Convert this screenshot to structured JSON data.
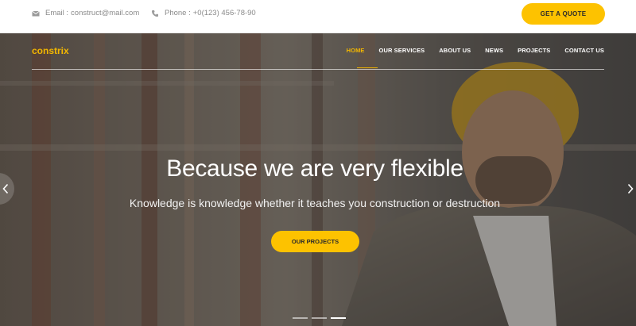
{
  "topbar": {
    "email_label": "Email :",
    "email_value": "construct@mail.com",
    "phone_label": "Phone :",
    "phone_value": "+0(123) 456-78-90",
    "quote_button": "GET A QUOTE",
    "email_icon": "envelope-icon",
    "phone_icon": "phone-icon"
  },
  "header": {
    "logo": "constrix",
    "nav": [
      "HOME",
      "OUR SERVICES",
      "ABOUT US",
      "NEWS",
      "PROJECTS",
      "CONTACT US"
    ],
    "active_nav": "HOME"
  },
  "hero": {
    "headline": "Because we are very flexible",
    "subline": "Knowledge is knowledge whether it teaches you construction or destruction",
    "cta": "OUR PROJECTS",
    "prev_icon": "chevron-left-icon",
    "next_icon": "chevron-right-icon",
    "slide_count": 3,
    "active_slide": 3
  },
  "colors": {
    "accent": "#fdc200",
    "logo": "#f3b700",
    "topbar_text": "#8a8a8a"
  }
}
